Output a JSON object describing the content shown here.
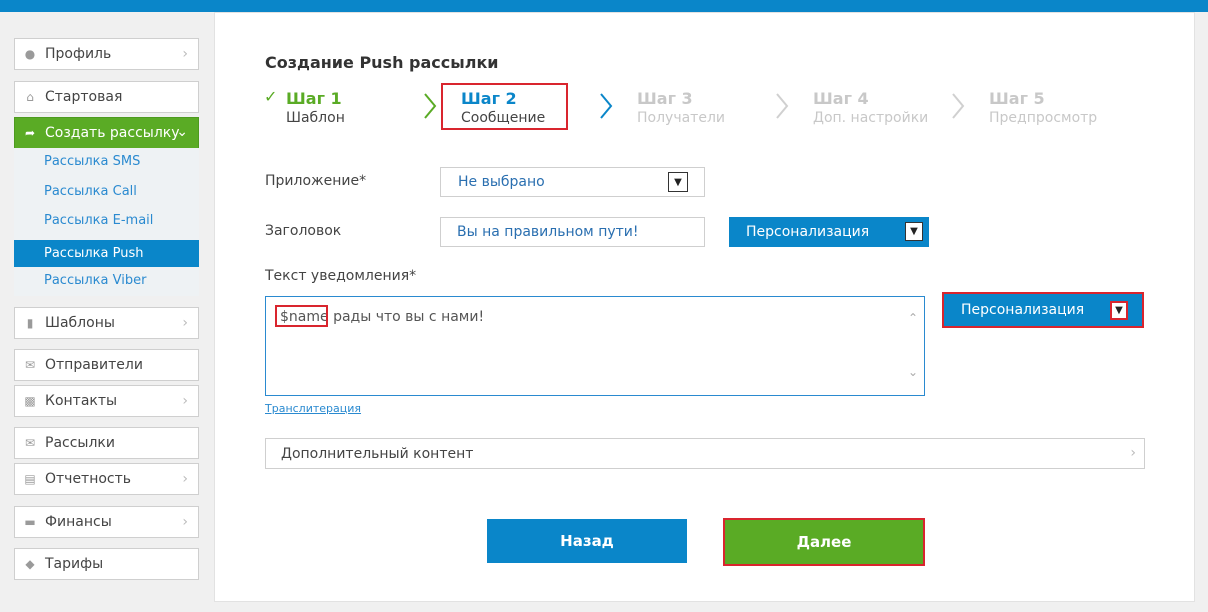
{
  "sidebar": {
    "items": [
      {
        "label": "Профиль",
        "icon": "user-icon"
      },
      {
        "label": "Стартовая",
        "icon": "home-icon"
      },
      {
        "label": "Создать рассылку",
        "icon": "share-arrow-icon"
      },
      {
        "label": "Шаблоны",
        "icon": "document-icon"
      },
      {
        "label": "Отправители",
        "icon": "sender-icon"
      },
      {
        "label": "Контакты",
        "icon": "contacts-icon"
      },
      {
        "label": "Рассылки",
        "icon": "envelope-icon"
      },
      {
        "label": "Отчетность",
        "icon": "report-icon"
      },
      {
        "label": "Финансы",
        "icon": "wallet-icon"
      },
      {
        "label": "Тарифы",
        "icon": "tag-icon"
      }
    ],
    "submenu": [
      {
        "label": "Рассылка SMS"
      },
      {
        "label": "Рассылка Call"
      },
      {
        "label": "Рассылка E-mail"
      },
      {
        "label": "Рассылка Push"
      },
      {
        "label": "Рассылка Viber"
      }
    ]
  },
  "main": {
    "title": "Создание Push рассылки",
    "steps": [
      {
        "title": "Шаг 1",
        "sub": "Шаблон",
        "state": "done"
      },
      {
        "title": "Шаг 2",
        "sub": "Сообщение",
        "state": "current"
      },
      {
        "title": "Шаг 3",
        "sub": "Получатели",
        "state": "todo"
      },
      {
        "title": "Шаг 4",
        "sub": "Доп. настройки",
        "state": "todo"
      },
      {
        "title": "Шаг 5",
        "sub": "Предпросмотр",
        "state": "todo"
      }
    ],
    "app_label": "Приложение*",
    "app_value": "Не выбрано",
    "header_label": "Заголовок",
    "header_value": "Вы на правильном пути!",
    "personalization_label": "Персонализация",
    "text_label": "Текст уведомления*",
    "text_var": "$name",
    "text_rest": " рады что вы с нами!",
    "translit": "Транслитерация",
    "extra_content": "Дополнительный контент",
    "back_label": "Назад",
    "next_label": "Далее"
  },
  "colors": {
    "accent": "#0a86c9",
    "success": "#5aab25",
    "highlight": "#d9252e"
  }
}
